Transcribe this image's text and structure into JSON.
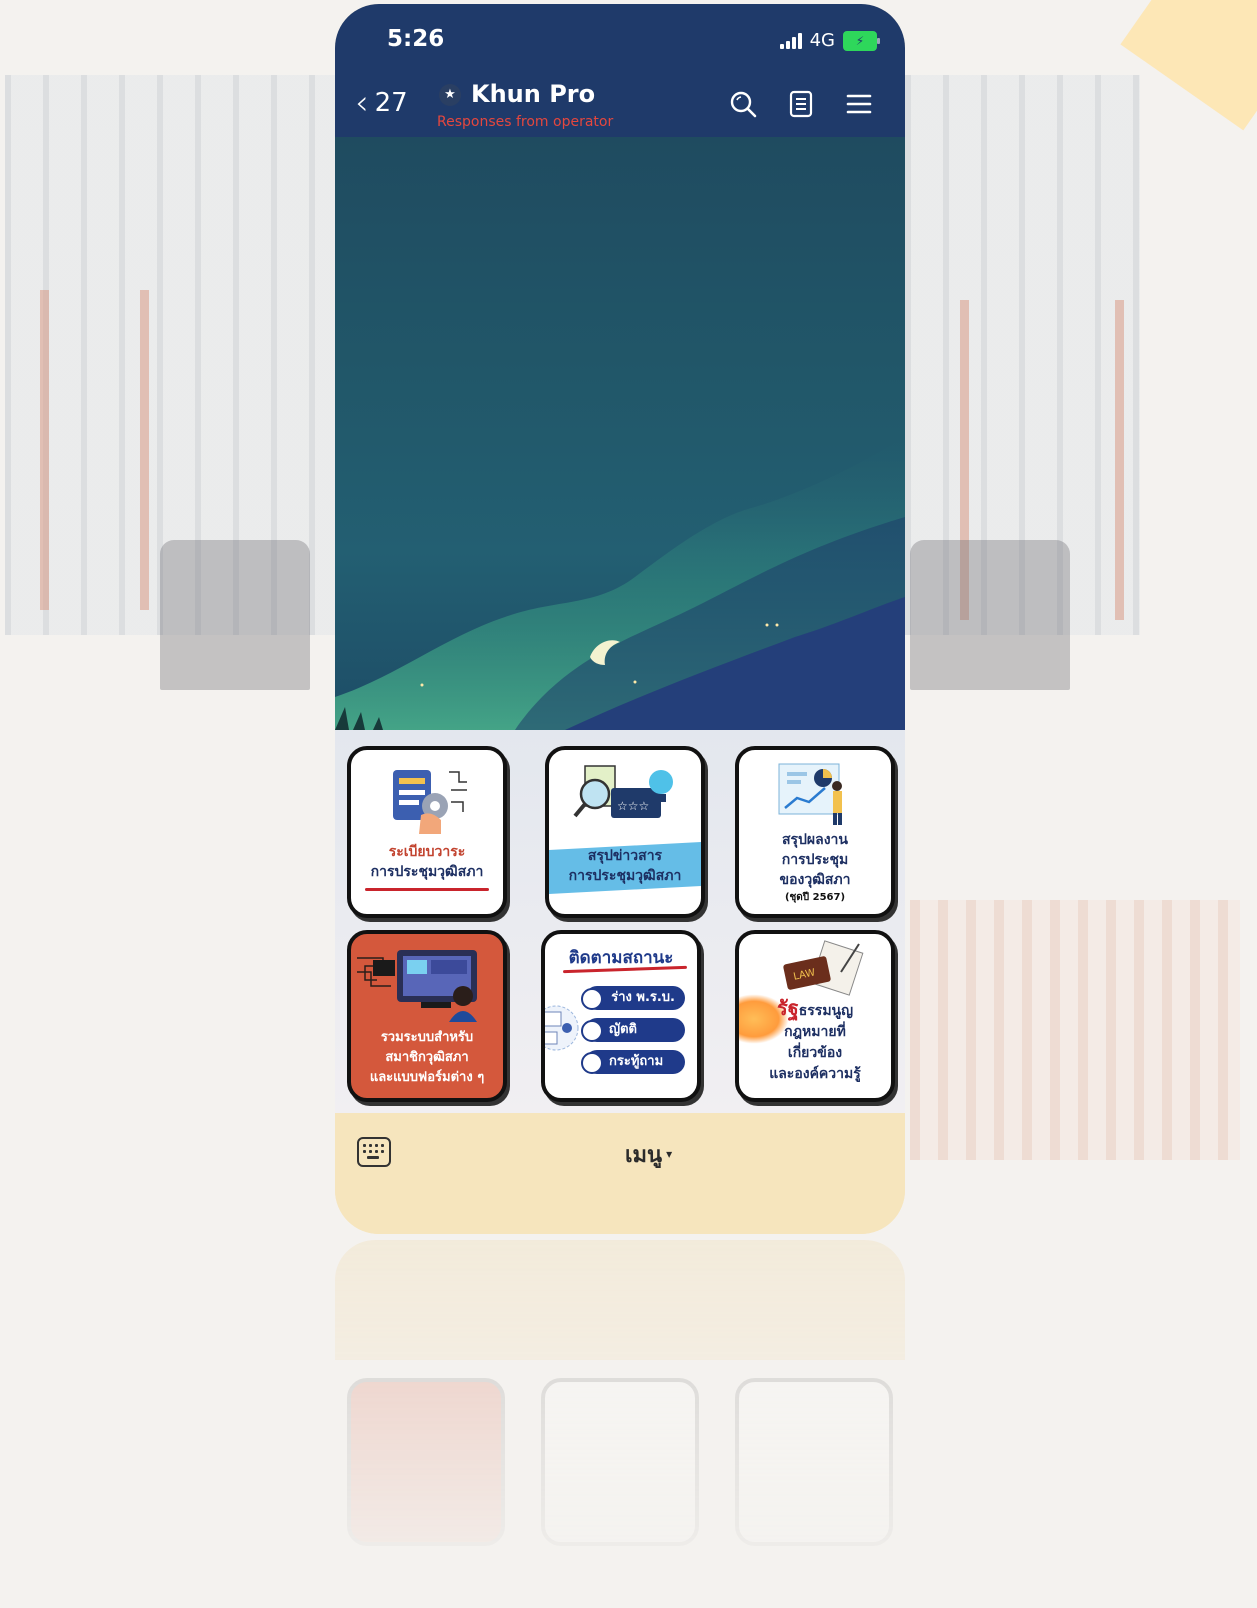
{
  "status_bar": {
    "time": "5:26",
    "network": "4G"
  },
  "header": {
    "back_count": "27",
    "title": "Khun Pro",
    "subtitle": "Responses from operator",
    "icons": [
      "search-icon",
      "notes-icon",
      "menu-icon"
    ]
  },
  "rich_menu": {
    "tiles": [
      {
        "label_lines": [
          "ระเบียบวาระ",
          "การประชุมวุฒิสภา"
        ],
        "icon": "agenda-illustration"
      },
      {
        "label_lines": [
          "สรุปข่าวสาร",
          "การประชุมวุฒิสภา"
        ],
        "icon": "news-summary-illustration"
      },
      {
        "label_lines": [
          "สรุปผลงาน",
          "การประชุม",
          "ของวุฒิสภา"
        ],
        "note": "(ชุดปี 2567)",
        "icon": "performance-report-illustration"
      },
      {
        "label_lines": [
          "รวมระบบสำหรับ",
          "สมาชิกวุฒิสภา",
          "และแบบฟอร์มต่าง ๆ"
        ],
        "icon": "systems-computer-illustration"
      },
      {
        "heading": "ติดตามสถานะ",
        "pills": [
          "ร่าง พ.ร.บ.",
          "ญัตติ",
          "กระทู้ถาม"
        ],
        "icon": "status-tracking-illustration"
      },
      {
        "heading_accent": "รัฐ",
        "label_lines": [
          "ธรรมนูญ",
          "กฎหมายที่",
          "เกี่ยวข้อง",
          "และองค์ความรู้"
        ],
        "icon_text": "LAW",
        "icon": "law-book-illustration"
      }
    ]
  },
  "bottom_bar": {
    "menu_label": "เมนู",
    "menu_caret": "▾"
  },
  "colors": {
    "header_bg": "#1f3a6a",
    "subtitle": "#e4473e",
    "bottom_bar": "#f6e5bd",
    "tile_text": "#1d2f62",
    "tile4_bg": "#d4583c"
  }
}
